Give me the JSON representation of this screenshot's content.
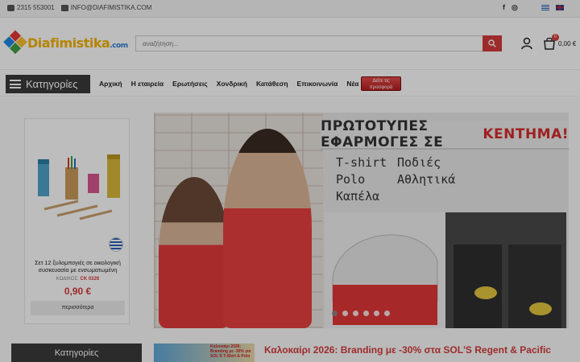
{
  "topbar": {
    "phone": "2315 553001",
    "email": "INFO@DIAFIMISTIKA.COM",
    "social": [
      "f",
      "◎"
    ]
  },
  "header": {
    "logo_text": "Diafimistika",
    "logo_suffix": ".com",
    "search_placeholder": "αναζήτηση...",
    "cart_count": "0",
    "cart_total": "0,00 €"
  },
  "nav": {
    "categories_label": "Κατηγορίες",
    "items": [
      "Αρχική",
      "Η εταιρεία",
      "Ερωτήσεις",
      "Χονδρική",
      "Κατάθεση",
      "Επικοινωνία",
      "Νέα"
    ],
    "offers_line1": "Δείτε τις",
    "offers_line2": "προσφορά"
  },
  "product": {
    "title": "Σετ 12 ξυλομπογιές σε οικολογική συσκευασία με ενσωματωμένη ξύστρα (CK 0326)",
    "code_label": "ΚΩΔΙΚΟΣ:",
    "code": "CK 0326",
    "price": "0,90 €",
    "more_label": "περισσότερα"
  },
  "banner": {
    "headline_main": "ΠΡΩΤΟΤΥΠΕΣ ΕΦΑΡΜΟΓΕΣ ΣΕ",
    "headline_accent": "ΚΕΝΤΗΜΑ!",
    "words_left": [
      "T-shirt",
      "Polo",
      "Καπέλα"
    ],
    "words_right": [
      "Ποδιές",
      "Αθλητικά"
    ],
    "slide_count": 6,
    "active_slide": 0
  },
  "sidebar": {
    "categories_title": "Κατηγορίες"
  },
  "news": {
    "thumb_text": "Καλοκαίρι 2026: Branding με -30% για SOL'S T-Shirt & Polo",
    "title": "Καλοκαίρι 2026: Branding με -30% στα SOL'S Regent & Pacific"
  }
}
